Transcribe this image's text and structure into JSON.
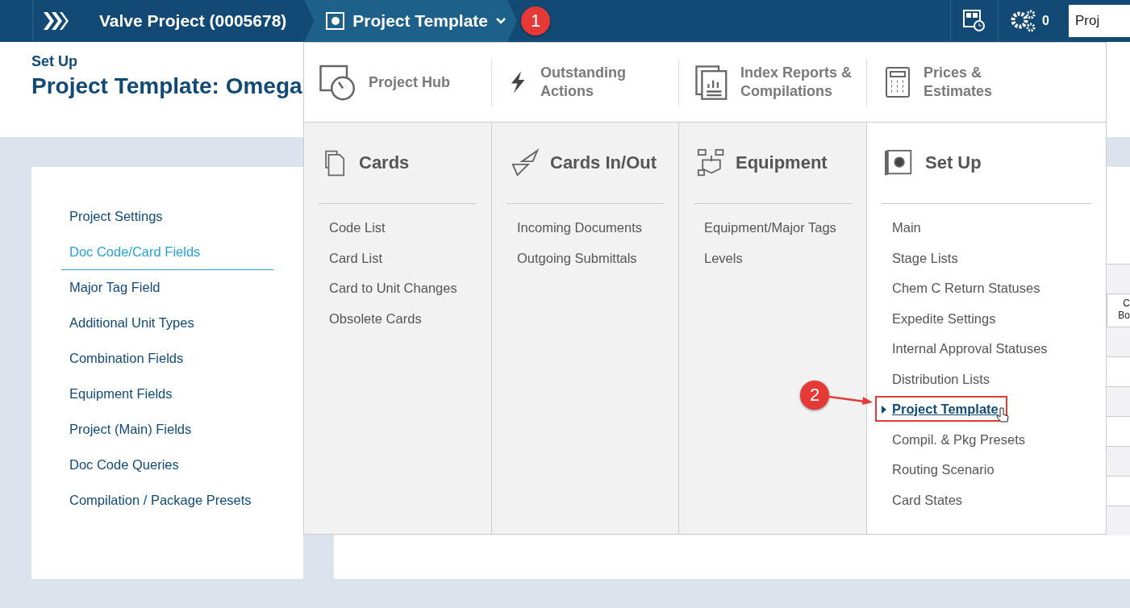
{
  "top_bar": {
    "breadcrumbs": [
      {
        "label": "Valve Project (0005678)",
        "selected": false
      },
      {
        "label": "Project Template",
        "selected": true
      }
    ],
    "gear_count": "0",
    "search": {
      "value": "Proj"
    }
  },
  "header": {
    "section": "Set Up",
    "title": "Project Template: Omega"
  },
  "sidebar": {
    "items": [
      {
        "label": "Project Settings",
        "selected": false
      },
      {
        "label": "Doc Code/Card Fields",
        "selected": true
      },
      {
        "label": "Major Tag Field",
        "selected": false
      },
      {
        "label": "Additional Unit Types",
        "selected": false
      },
      {
        "label": "Combination Fields",
        "selected": false
      },
      {
        "label": "Equipment Fields",
        "selected": false
      },
      {
        "label": "Project (Main) Fields",
        "selected": false
      },
      {
        "label": "Doc Code Queries",
        "selected": false
      },
      {
        "label": "Compilation / Package Presets",
        "selected": false
      }
    ]
  },
  "table": {
    "column_1": {
      "lines": [
        "C",
        "Bo"
      ]
    }
  },
  "menu": {
    "shortcuts": [
      {
        "kind": "hub",
        "label": "Project Hub"
      },
      {
        "kind": "actions",
        "label": "Outstanding Actions"
      },
      {
        "kind": "reports",
        "label": "Index Reports & Compilations"
      },
      {
        "kind": "prices",
        "label": "Prices & Estimates"
      }
    ],
    "columns": [
      {
        "kind": "cards",
        "title": "Cards",
        "selected": false,
        "items": [
          {
            "label": "Code List",
            "selected": false
          },
          {
            "label": "Card List",
            "selected": false
          },
          {
            "label": "Card to Unit Changes",
            "selected": false
          },
          {
            "label": "Obsolete Cards",
            "selected": false
          }
        ]
      },
      {
        "kind": "inout",
        "title": "Cards In/Out",
        "selected": false,
        "items": [
          {
            "label": "Incoming Documents",
            "selected": false
          },
          {
            "label": "Outgoing Submittals",
            "selected": false
          }
        ]
      },
      {
        "kind": "equipment",
        "title": "Equipment",
        "selected": false,
        "items": [
          {
            "label": "Equipment/Major Tags",
            "selected": false
          },
          {
            "label": "Levels",
            "selected": false
          }
        ]
      },
      {
        "kind": "setup",
        "title": "Set Up",
        "selected": true,
        "items": [
          {
            "label": "Main",
            "selected": false
          },
          {
            "label": "Stage Lists",
            "selected": false
          },
          {
            "label": "Chem C Return Statuses",
            "selected": false
          },
          {
            "label": "Expedite Settings",
            "selected": false
          },
          {
            "label": "Internal Approval Statuses",
            "selected": false
          },
          {
            "label": "Distribution Lists",
            "selected": false
          },
          {
            "label": "Project Template",
            "selected": true
          },
          {
            "label": "Compil. & Pkg Presets",
            "selected": false
          },
          {
            "label": "Routing Scenario",
            "selected": false
          },
          {
            "label": "Card States",
            "selected": false
          }
        ]
      }
    ]
  },
  "annotations": [
    {
      "label": "1"
    },
    {
      "label": "2"
    }
  ]
}
